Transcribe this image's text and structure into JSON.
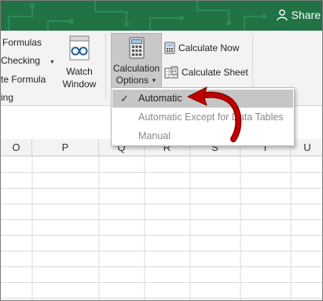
{
  "title_bar": {
    "share_label": "Share",
    "bg_color": "#217346",
    "pattern_color": "#2e8a57"
  },
  "ribbon": {
    "left_group": [
      {
        "label": "Formulas"
      },
      {
        "label": "Checking"
      },
      {
        "label": "te Formula"
      },
      {
        "label": "ing"
      }
    ],
    "watch_window": {
      "line1": "Watch",
      "line2": "Window",
      "icon": "glasses-icon"
    },
    "calculation_options": {
      "line1": "Calculation",
      "line2": "Options",
      "icon": "calculator-icon"
    },
    "calculate_now": {
      "label": "Calculate Now",
      "icon": "calculator-small-icon"
    },
    "calculate_sheet": {
      "label": "Calculate Sheet",
      "icon": "calculator-sheet-icon"
    }
  },
  "menu": {
    "items": [
      {
        "label": "Automatic",
        "checked": true,
        "highlighted": true,
        "enabled": true
      },
      {
        "label": "Automatic Except for Data Tables",
        "checked": false,
        "highlighted": false,
        "enabled": false
      },
      {
        "label": "Manual",
        "checked": false,
        "highlighted": false,
        "enabled": false
      }
    ]
  },
  "columns": [
    "O",
    "P",
    "Q",
    "R",
    "S",
    "T",
    "U"
  ],
  "annotation": {
    "arrow_color": "#c00000",
    "arrow_icon": "curved-arrow-icon"
  }
}
